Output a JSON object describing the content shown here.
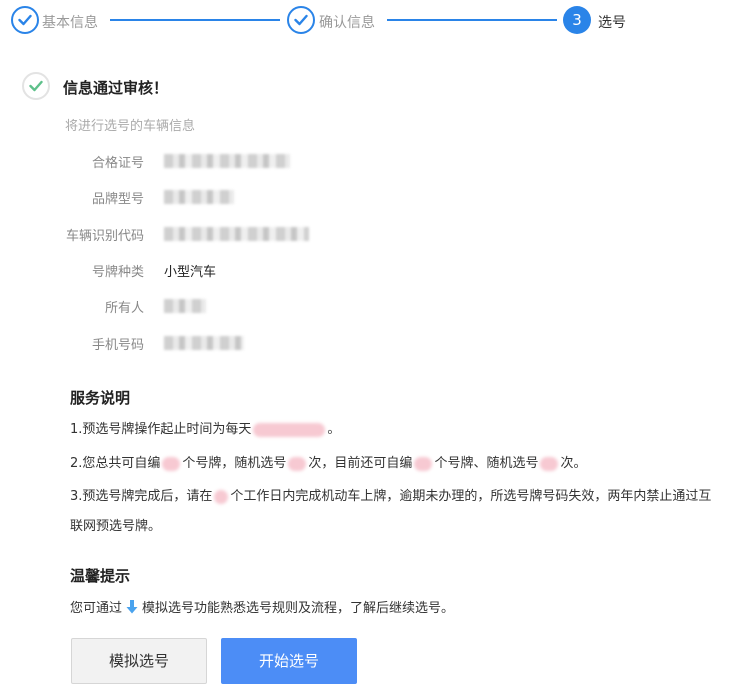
{
  "steps": [
    {
      "label": "基本信息",
      "state": "done"
    },
    {
      "label": "确认信息",
      "state": "done"
    },
    {
      "number": "3",
      "label": "选号",
      "state": "active"
    }
  ],
  "success": {
    "title": "信息通过审核！"
  },
  "vehicle": {
    "subtitle": "将进行选号的车辆信息",
    "fields": [
      {
        "label": "合格证号",
        "value": ""
      },
      {
        "label": "品牌型号",
        "value": ""
      },
      {
        "label": "车辆识别代码",
        "value": ""
      },
      {
        "label": "号牌种类",
        "value": "小型汽车"
      },
      {
        "label": "所有人",
        "value": ""
      },
      {
        "label": "手机号码",
        "value": ""
      }
    ]
  },
  "service": {
    "title": "服务说明",
    "line1": {
      "a": "1.预选号牌操作起止时间为每天",
      "b": "。"
    },
    "line2": {
      "a": "2.您总共可自编",
      "b": "个号牌，随机选号",
      "c": "次，目前还可自编",
      "d": "个号牌、随机选号",
      "e": "次。"
    },
    "line3": {
      "a": "3.预选号牌完成后，请在",
      "b": "个工作日内完成机动车上牌，逾期未办理的，所选号牌号码失效，两年内禁止通过互"
    },
    "line3_cont": "联网预选号牌。"
  },
  "tips": {
    "title": "温馨提示",
    "text_before": "您可通过",
    "text_after": "模拟选号功能熟悉选号规则及流程，了解后继续选号。"
  },
  "buttons": {
    "simulate": "模拟选号",
    "start": "开始选号"
  },
  "colors": {
    "primary": "#2a84e8",
    "start_button": "#4c8df6",
    "success_check": "#5ec08a"
  }
}
